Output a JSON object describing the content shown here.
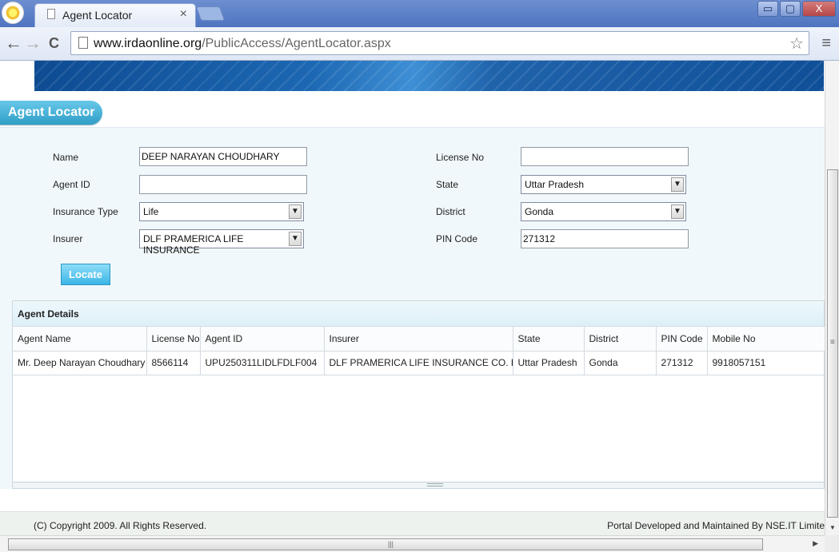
{
  "browser": {
    "tab_title": "Agent Locator",
    "tab_close": "×",
    "url_host": "www.irdaonline.org",
    "url_path": "/PublicAccess/AgentLocator.aspx",
    "window_buttons": [
      "▭",
      "▢",
      "X"
    ]
  },
  "page": {
    "section_title": "Agent Locator",
    "form": {
      "name_label": "Name",
      "name_value": "DEEP NARAYAN CHOUDHARY",
      "agent_id_label": "Agent ID",
      "agent_id_value": "",
      "insurance_type_label": "Insurance Type",
      "insurance_type_value": "Life",
      "insurer_label": "Insurer",
      "insurer_value": "DLF PRAMERICA LIFE INSURANCE",
      "license_no_label": "License No",
      "license_no_value": "",
      "state_label": "State",
      "state_value": "Uttar Pradesh",
      "district_label": "District",
      "district_value": "Gonda",
      "pin_code_label": "PIN Code",
      "pin_code_value": "271312",
      "locate_button": "Locate"
    },
    "agent_details": {
      "title": "Agent Details",
      "columns": [
        "Agent Name",
        "License No",
        "Agent ID",
        "Insurer",
        "State",
        "District",
        "PIN Code",
        "Mobile No"
      ],
      "rows": [
        [
          "Mr. Deep Narayan Choudhary",
          "8566114",
          "UPU250311LIDLFDLF004",
          "DLF PRAMERICA LIFE INSURANCE CO. LTD",
          "Uttar Pradesh",
          "Gonda",
          "271312",
          "9918057151"
        ]
      ]
    },
    "footer": {
      "left": "(C) Copyright 2009. All Rights Reserved.",
      "right": "Portal Developed and Maintained By NSE.IT Limite"
    }
  },
  "icons": {
    "back": "←",
    "forward": "→",
    "reload": "C",
    "star": "☆",
    "menu": "≡",
    "select_arrow": "▼",
    "scroll_down": "▼",
    "scroll_right": "▶"
  }
}
